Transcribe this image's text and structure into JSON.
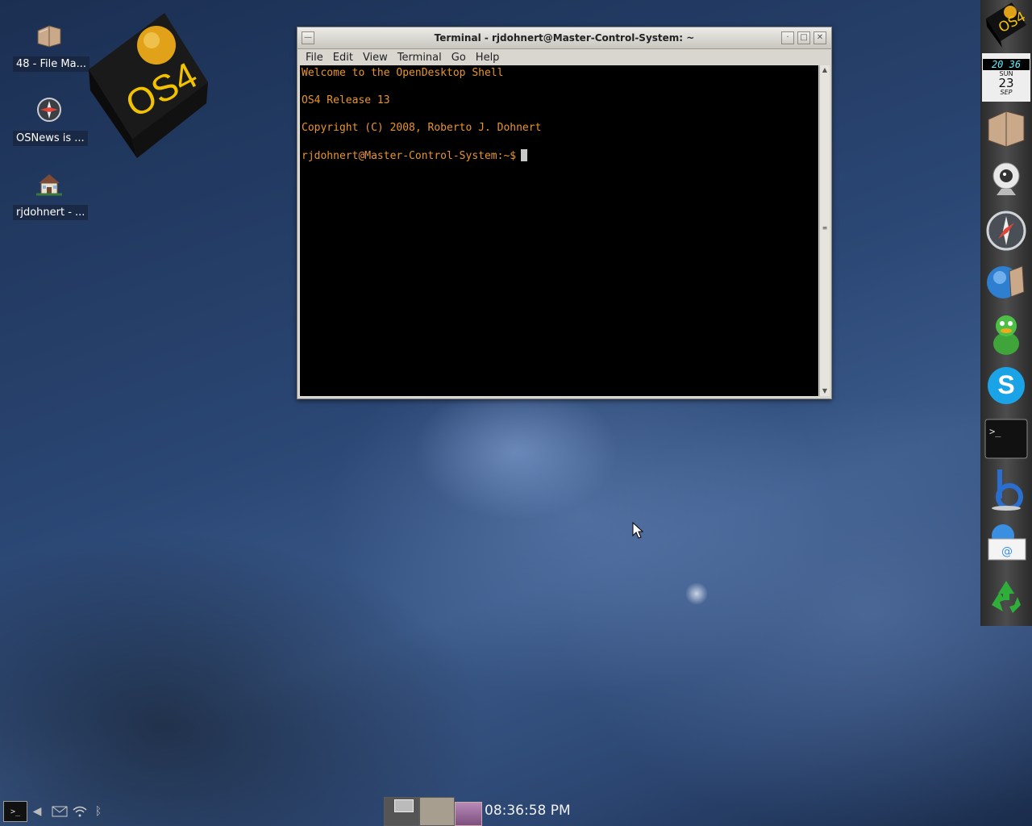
{
  "desktop": {
    "icons": [
      {
        "label": "48 - File Ma...",
        "icon": "folder-icon"
      },
      {
        "label": "OSNews is ...",
        "icon": "compass-icon"
      },
      {
        "label": "rjdohnert - ...",
        "icon": "home-icon"
      }
    ],
    "logo_text": "OS4"
  },
  "terminal": {
    "title": "Terminal - rjdohnert@Master-Control-System: ~",
    "menu": [
      "File",
      "Edit",
      "View",
      "Terminal",
      "Go",
      "Help"
    ],
    "lines": [
      "Welcome to the OpenDesktop Shell",
      "OS4 Release 13",
      "Copyright (C) 2008, Roberto J. Dohnert"
    ],
    "prompt": "rjdohnert@Master-Control-System:~$",
    "text_color": "#e8952a"
  },
  "dock": {
    "logo_text": "OS4",
    "clock_widget": {
      "time": "20 36",
      "day": "SUN",
      "date": "23",
      "month": "SEP"
    },
    "apps": [
      "file-manager-icon",
      "webcam-icon",
      "safari-compass-icon",
      "network-browser-icon",
      "adium-duck-icon",
      "skype-icon",
      "terminal-icon",
      "beep-media-icon",
      "mail-icon",
      "recycle-bin-icon"
    ]
  },
  "taskbar": {
    "tray": [
      "terminal-icon",
      "volume-icon",
      "mail-icon",
      "wifi-icon",
      "bluetooth-icon"
    ],
    "clock": "08:36:58 PM"
  }
}
